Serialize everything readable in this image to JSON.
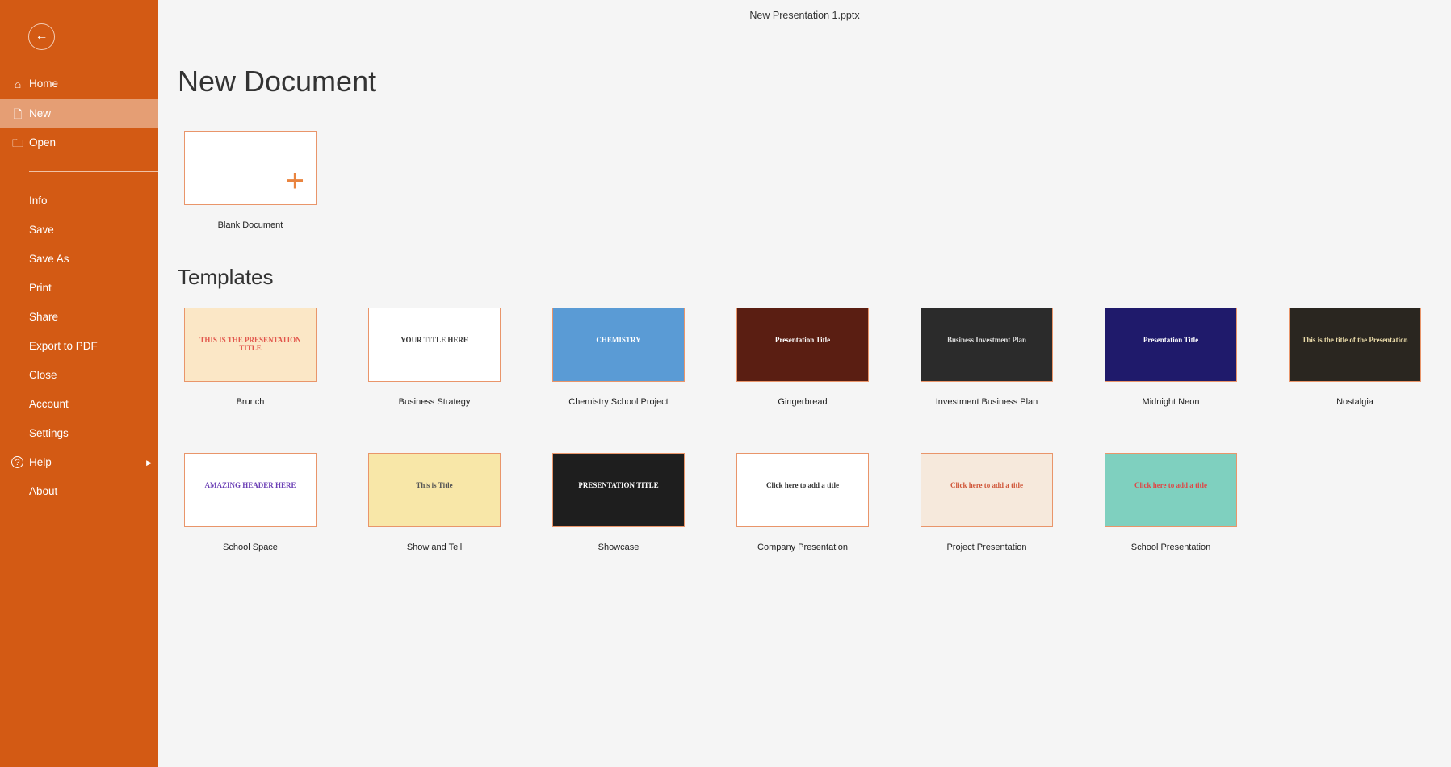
{
  "window": {
    "title": "New Presentation 1.pptx"
  },
  "sidebar": {
    "back_icon": "arrow-left-icon",
    "items": [
      {
        "label": "Home",
        "icon": "home-icon"
      },
      {
        "label": "New",
        "icon": "document-icon",
        "active": true
      },
      {
        "label": "Open",
        "icon": "folder-icon"
      },
      {
        "label": "Info"
      },
      {
        "label": "Save"
      },
      {
        "label": "Save As"
      },
      {
        "label": "Print"
      },
      {
        "label": "Share"
      },
      {
        "label": "Export to PDF"
      },
      {
        "label": "Close"
      },
      {
        "label": "Account"
      },
      {
        "label": "Settings"
      },
      {
        "label": "Help",
        "icon": "help-icon",
        "submenu": true
      },
      {
        "label": "About"
      }
    ]
  },
  "main": {
    "title": "New Document",
    "blank": {
      "label": "Blank Document"
    },
    "templates_title": "Templates",
    "templates": [
      {
        "label": "Brunch",
        "thumb_text": "THIS IS THE PRESENTATION TITLE",
        "bg": "#fbe7c6",
        "fg": "#e2574c"
      },
      {
        "label": "Business Strategy",
        "thumb_text": "YOUR TITLE HERE",
        "bg": "#ffffff",
        "fg": "#333333"
      },
      {
        "label": "Chemistry School Project",
        "thumb_text": "CHEMISTRY",
        "bg": "#5a9bd5",
        "fg": "#ffffff"
      },
      {
        "label": "Gingerbread",
        "thumb_text": "Presentation Title",
        "bg": "#5a1e12",
        "fg": "#ffffff"
      },
      {
        "label": "Investment Business Plan",
        "thumb_text": "Business Investment Plan",
        "bg": "#2b2b2b",
        "fg": "#dddddd"
      },
      {
        "label": "Midnight Neon",
        "thumb_text": "Presentation Title",
        "bg": "#1f1a6b",
        "fg": "#ffffff"
      },
      {
        "label": "Nostalgia",
        "thumb_text": "This is the title of the Presentation",
        "bg": "#2a2620",
        "fg": "#e8d9a8"
      },
      {
        "label": "School Space",
        "thumb_text": "AMAZING HEADER HERE",
        "bg": "#ffffff",
        "fg": "#6b3fb5"
      },
      {
        "label": "Show and Tell",
        "thumb_text": "This is Title",
        "bg": "#f8e7a8",
        "fg": "#555555"
      },
      {
        "label": "Showcase",
        "thumb_text": "PRESENTATION TITLE",
        "bg": "#1e1e1e",
        "fg": "#ffffff"
      },
      {
        "label": "Company Presentation",
        "thumb_text": "Click here to add a title",
        "bg": "#ffffff",
        "fg": "#333333"
      },
      {
        "label": "Project Presentation",
        "thumb_text": "Click here to add a title",
        "bg": "#f6e9dc",
        "fg": "#d0573a"
      },
      {
        "label": "School Presentation",
        "thumb_text": "Click here to add a title",
        "bg": "#7fd0bf",
        "fg": "#e04545"
      }
    ]
  },
  "colors": {
    "accent": "#d35a14",
    "active_item": "#e59e74",
    "thumb_border": "#e9956a"
  }
}
